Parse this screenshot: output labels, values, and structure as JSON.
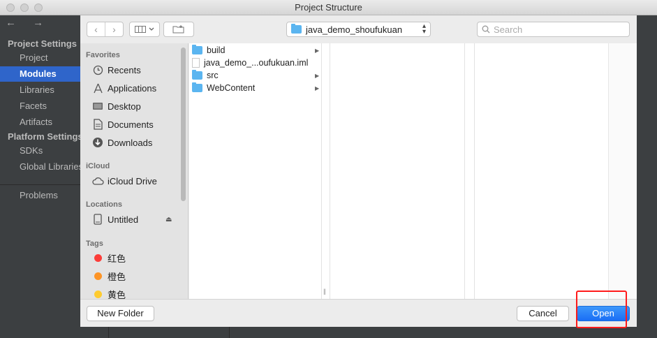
{
  "window": {
    "title": "Project Structure"
  },
  "ide_sidebar": {
    "nav_arrows": "← →",
    "items": [
      {
        "label": "Project Settings",
        "type": "header"
      },
      {
        "label": "Project",
        "type": "item"
      },
      {
        "label": "Modules",
        "type": "selected"
      },
      {
        "label": "Libraries",
        "type": "item"
      },
      {
        "label": "Facets",
        "type": "item"
      },
      {
        "label": "Artifacts",
        "type": "item"
      },
      {
        "label": "Platform Settings",
        "type": "header"
      },
      {
        "label": "SDKs",
        "type": "item"
      },
      {
        "label": "Global Libraries",
        "type": "item"
      },
      {
        "label": "Problems",
        "type": "item"
      }
    ]
  },
  "toolbar": {
    "back_icon": "chevron-left-icon",
    "forward_icon": "chevron-right-icon",
    "view_icon": "column-view-icon",
    "new_folder_icon": "new-folder-icon",
    "current_folder": "java_demo_shoufukuan",
    "search_placeholder": "Search"
  },
  "sidebar": {
    "sections": {
      "favorites": "Favorites",
      "icloud": "iCloud",
      "locations": "Locations",
      "tags": "Tags"
    },
    "favorites": [
      {
        "label": "Recents",
        "icon": "clock-icon"
      },
      {
        "label": "Applications",
        "icon": "applications-icon"
      },
      {
        "label": "Desktop",
        "icon": "desktop-icon"
      },
      {
        "label": "Documents",
        "icon": "documents-icon"
      },
      {
        "label": "Downloads",
        "icon": "downloads-icon"
      }
    ],
    "icloud": [
      {
        "label": "iCloud Drive",
        "icon": "cloud-icon"
      }
    ],
    "locations": [
      {
        "label": "Untitled",
        "icon": "disk-icon"
      }
    ],
    "tags": [
      {
        "label": "红色",
        "color": "#fc3d39"
      },
      {
        "label": "橙色",
        "color": "#fd9426"
      },
      {
        "label": "黄色",
        "color": "#fecb2f"
      }
    ]
  },
  "files": [
    {
      "name": "build",
      "kind": "folder",
      "has_children": true
    },
    {
      "name": "java_demo_...oufukuan.iml",
      "kind": "file",
      "has_children": false
    },
    {
      "name": "src",
      "kind": "folder",
      "has_children": true
    },
    {
      "name": "WebContent",
      "kind": "folder",
      "has_children": true
    }
  ],
  "buttons": {
    "new_folder": "New Folder",
    "cancel": "Cancel",
    "open": "Open"
  },
  "colors": {
    "accent": "#1a6ef5",
    "ide_selection": "#2f65ca",
    "highlight_box": "#ff1a1a",
    "folder": "#5bb5f0"
  }
}
